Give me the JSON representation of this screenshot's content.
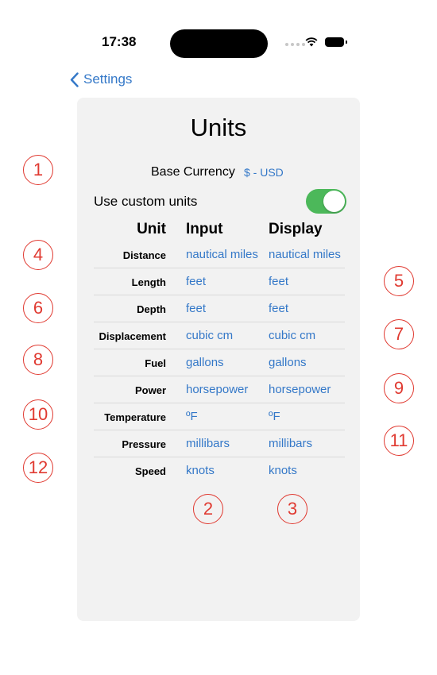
{
  "status_bar": {
    "time": "17:38"
  },
  "nav": {
    "back_label": "Settings"
  },
  "page": {
    "title": "Units"
  },
  "currency": {
    "label": "Base Currency",
    "value": "$ - USD"
  },
  "custom_units": {
    "label": "Use custom units",
    "enabled": true
  },
  "table": {
    "headers": {
      "unit": "Unit",
      "input": "Input",
      "display": "Display"
    },
    "rows": [
      {
        "name": "Distance",
        "input": "nautical miles",
        "display": "nautical miles"
      },
      {
        "name": "Length",
        "input": "feet",
        "display": "feet"
      },
      {
        "name": "Depth",
        "input": "feet",
        "display": "feet"
      },
      {
        "name": "Displacement",
        "input": "cubic cm",
        "display": "cubic cm"
      },
      {
        "name": "Fuel",
        "input": "gallons",
        "display": "gallons"
      },
      {
        "name": "Power",
        "input": "horsepower",
        "display": "horsepower"
      },
      {
        "name": "Temperature",
        "input": "ºF",
        "display": "ºF"
      },
      {
        "name": "Pressure",
        "input": "millibars",
        "display": "millibars"
      },
      {
        "name": "Speed",
        "input": "knots",
        "display": "knots"
      }
    ]
  },
  "markers": [
    "1",
    "2",
    "3",
    "4",
    "5",
    "6",
    "7",
    "8",
    "9",
    "10",
    "11",
    "12"
  ],
  "colors": {
    "accent": "#3478c8",
    "toggle_on": "#4cb85a",
    "marker": "#e03a31"
  }
}
